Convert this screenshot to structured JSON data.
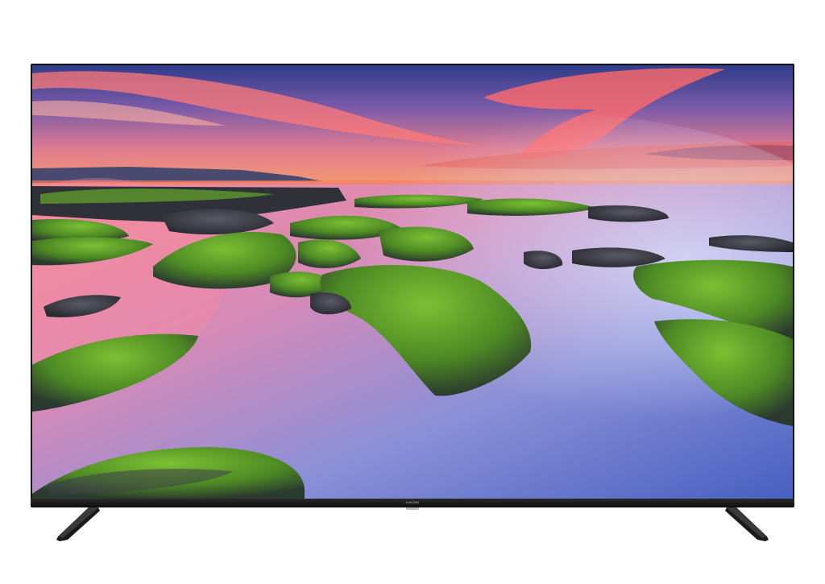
{
  "tv": {
    "brand_logo_text": "XIAOMI"
  },
  "colors": {
    "frame": "#141414",
    "sky_top": "#3c3a8c",
    "sky_horizon": "#f08a6a",
    "cloud_pink": "#ff6f6a",
    "water_pink": "#e58aa0",
    "water_blue": "#5a6fc4",
    "moss": "#5e9a2a",
    "rock": "#3a3a44"
  },
  "icons": {
    "left_stand": "left-stand-icon",
    "right_stand": "right-stand-icon"
  }
}
